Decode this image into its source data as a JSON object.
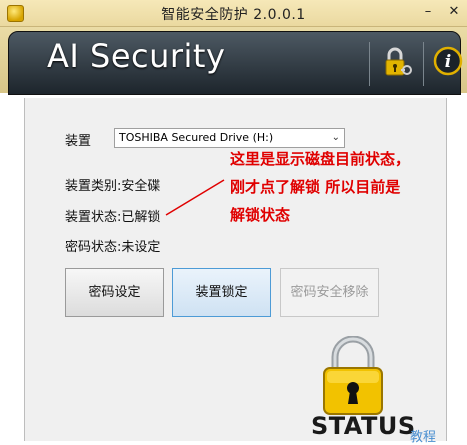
{
  "window": {
    "title": "智能安全防护 2.0.0.1",
    "minimize_glyph": "–",
    "close_glyph": "✕"
  },
  "banner": {
    "brand": "AI Security",
    "icons": [
      "lock-key-icon",
      "info-icon"
    ]
  },
  "form": {
    "device_label": "装置",
    "device_value": "TOSHIBA Secured Drive (H:)",
    "type_label": "装置类别:",
    "type_value": "安全碟",
    "state_label": "装置状态:",
    "state_value": "已解锁",
    "pwd_label": "密码状态:",
    "pwd_value": "未设定"
  },
  "annotation": {
    "text": "这里是显示磁盘目前状态，刚才点了解锁 所以目前是解锁状态",
    "color": "#e00000"
  },
  "buttons": {
    "set_password": "密码设定",
    "lock_device": "装置锁定",
    "secure_remove": "密码安全移除"
  },
  "status": {
    "label": "STATUS",
    "state": "locked",
    "watermark": "教程"
  }
}
